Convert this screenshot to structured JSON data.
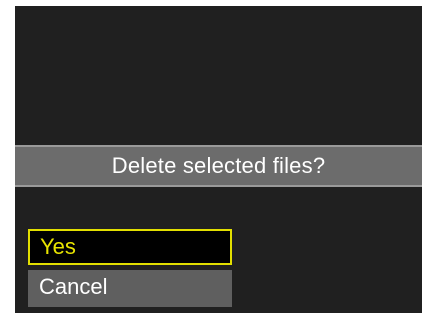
{
  "dialog": {
    "message": "Delete selected files?",
    "options": [
      {
        "label": "Yes",
        "selected": true
      },
      {
        "label": "Cancel",
        "selected": false
      }
    ]
  },
  "colors": {
    "screen_background": "#202020",
    "prompt_bar": "#6c6c6c",
    "highlight": "#e2df00",
    "option_background": "#5f5f5f"
  }
}
